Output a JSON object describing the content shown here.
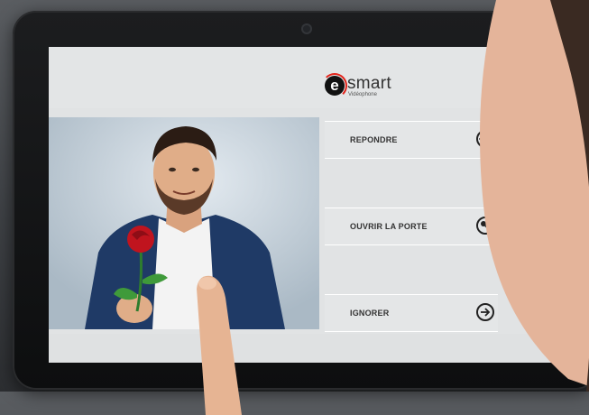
{
  "app": {
    "logo_letter": "e",
    "logo_name": "smart",
    "logo_subtitle": "Vidéophone"
  },
  "actions": [
    {
      "label": "REPONDRE",
      "icon": "eye-icon"
    },
    {
      "label": "OUVRIR LA PORTE",
      "icon": "key-icon"
    },
    {
      "label": "IGNORER",
      "icon": "arrow-right-icon"
    }
  ],
  "colors": {
    "brand_red": "#e2231a",
    "screen_bg": "#e1e3e4",
    "bezel": "#111213",
    "jacket": "#1f3a66"
  }
}
